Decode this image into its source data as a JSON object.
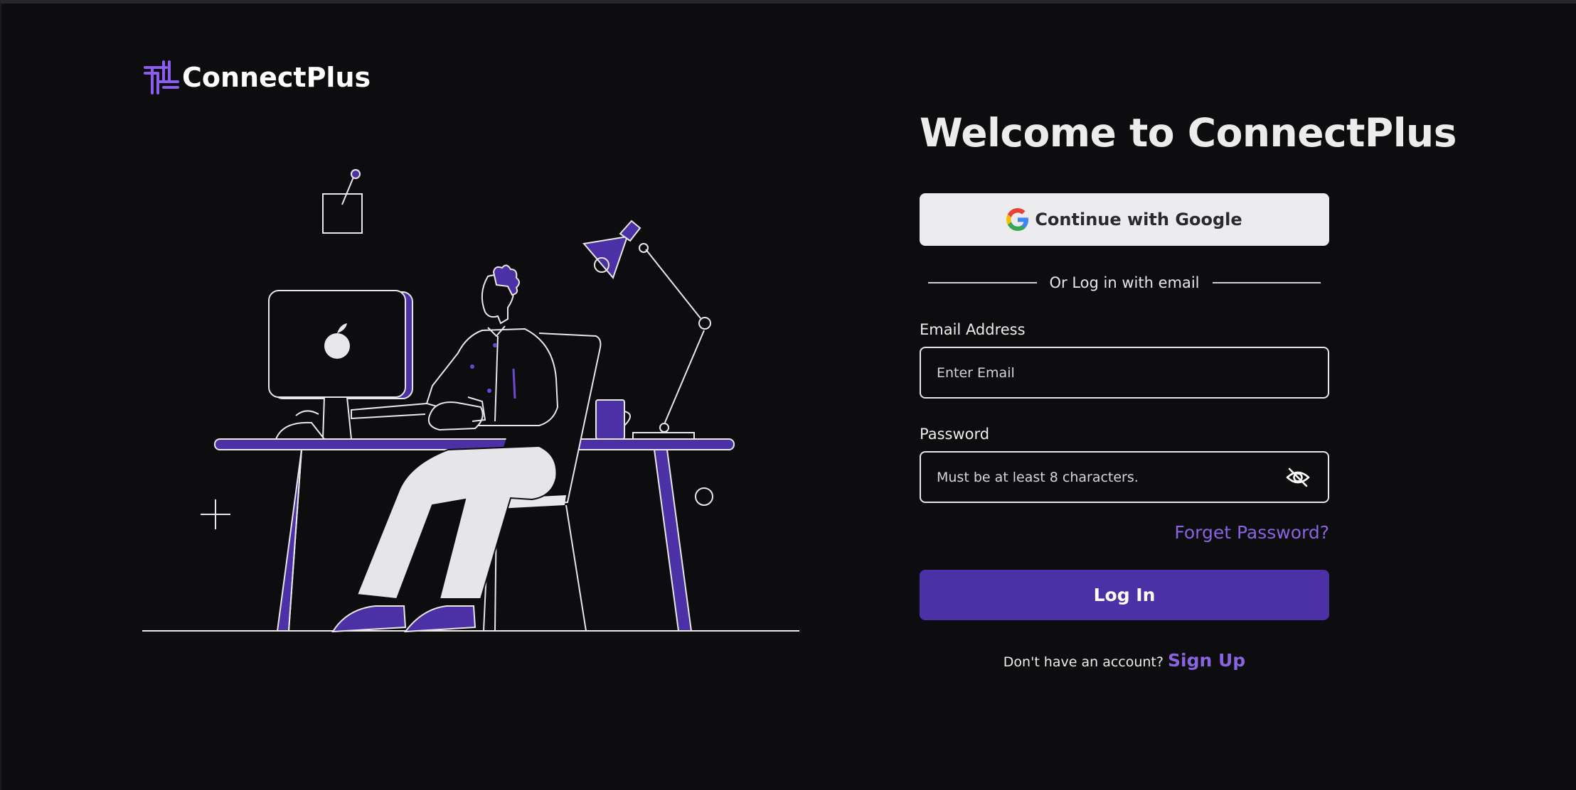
{
  "brand": {
    "name": "ConnectPlus",
    "accent_color": "#8a5cf0"
  },
  "illustration": {
    "icon": "person-at-desk-illustration",
    "accent_color": "#4c30a6"
  },
  "form": {
    "title": "Welcome to ConnectPlus",
    "google_button_label": "Continue with Google",
    "divider_text": "Or Log in with email",
    "email": {
      "label": "Email Address",
      "placeholder": "Enter Email",
      "value": ""
    },
    "password": {
      "label": "Password",
      "placeholder": "Must be at least 8 characters.",
      "value": "",
      "toggle_icon": "eye-off-icon"
    },
    "forget_password_label": "Forget Password?",
    "login_button_label": "Log In",
    "signup_prompt": "Don't have an account?",
    "signup_link_label": "Sign Up",
    "primary_color": "#4c30a6",
    "link_color": "#8a63e0"
  }
}
